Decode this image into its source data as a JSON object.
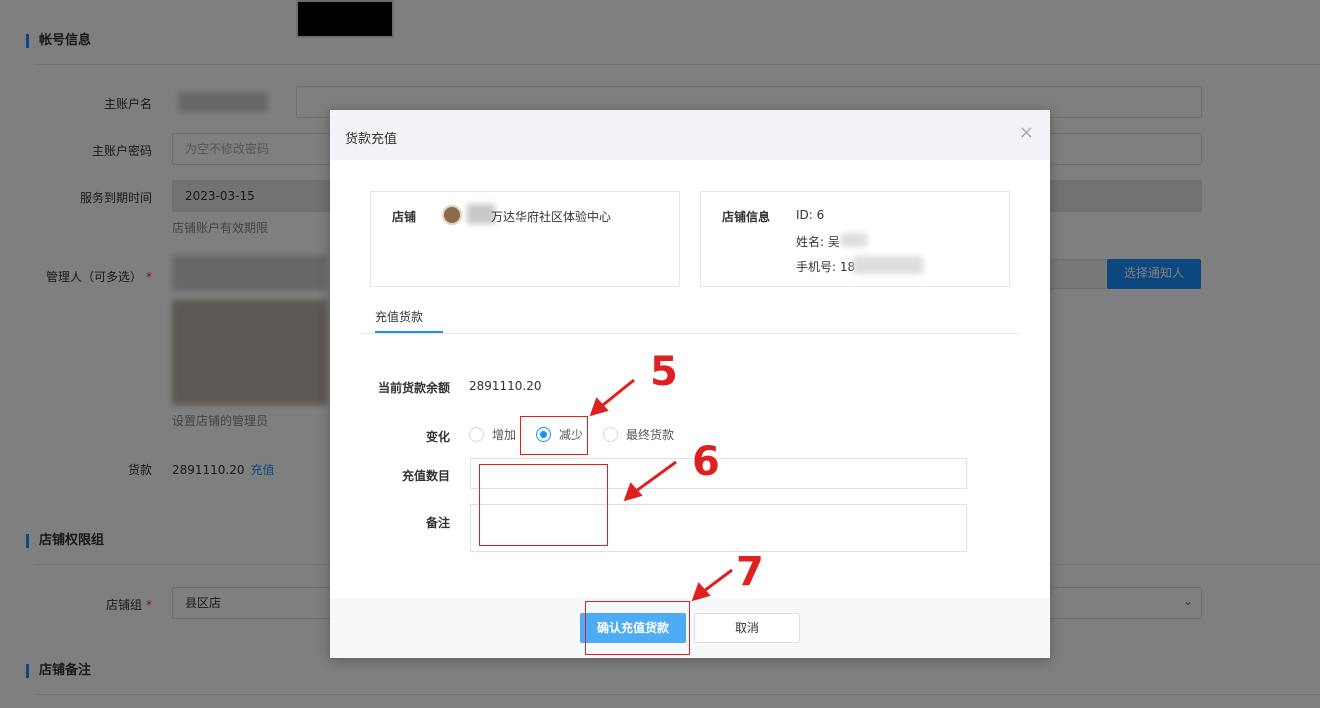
{
  "background": {
    "section_account": "帐号信息",
    "labels": {
      "main_account": "主账户名",
      "main_password": "主账户密码",
      "expire_time": "服务到期时间",
      "managers": "管理人（可多选）",
      "goods_money": "货款",
      "shop_group": "店铺组"
    },
    "password_placeholder": "为空不修改密码",
    "expire_value": "2023-03-15",
    "expire_hint": "店铺账户有效期限",
    "manager_hint": "设置店铺的管理员",
    "select_notify_button": "选择通知人",
    "goods_money_value": "2891110.20",
    "recharge_link": "充值",
    "section_permission": "店铺权限组",
    "shop_group_value": "县区店",
    "section_remark": "店铺备注",
    "required_mark": "*"
  },
  "modal": {
    "title": "货款充值",
    "close_symbol": "×",
    "shop_card": {
      "label": "店铺",
      "name": "万达华府社区体验中心"
    },
    "info_card": {
      "label": "店铺信息",
      "id_line": "ID: 6",
      "name_line": "姓名: 吴",
      "phone_line": "手机号: 18"
    },
    "tab": "充值货款",
    "balance_label": "当前货款余额",
    "balance_value": "2891110.20",
    "change_label": "变化",
    "options": [
      "增加",
      "减少",
      "最终货款"
    ],
    "selected_option": "减少",
    "amount_label": "充值数目",
    "remark_label": "备注",
    "confirm_button": "确认充值货款",
    "cancel_button": "取消"
  },
  "annotations": [
    "5",
    "6",
    "7"
  ],
  "colors": {
    "accent": "#1890ff",
    "primary_button": "#4eabf6",
    "annotation": "#e0201e"
  }
}
